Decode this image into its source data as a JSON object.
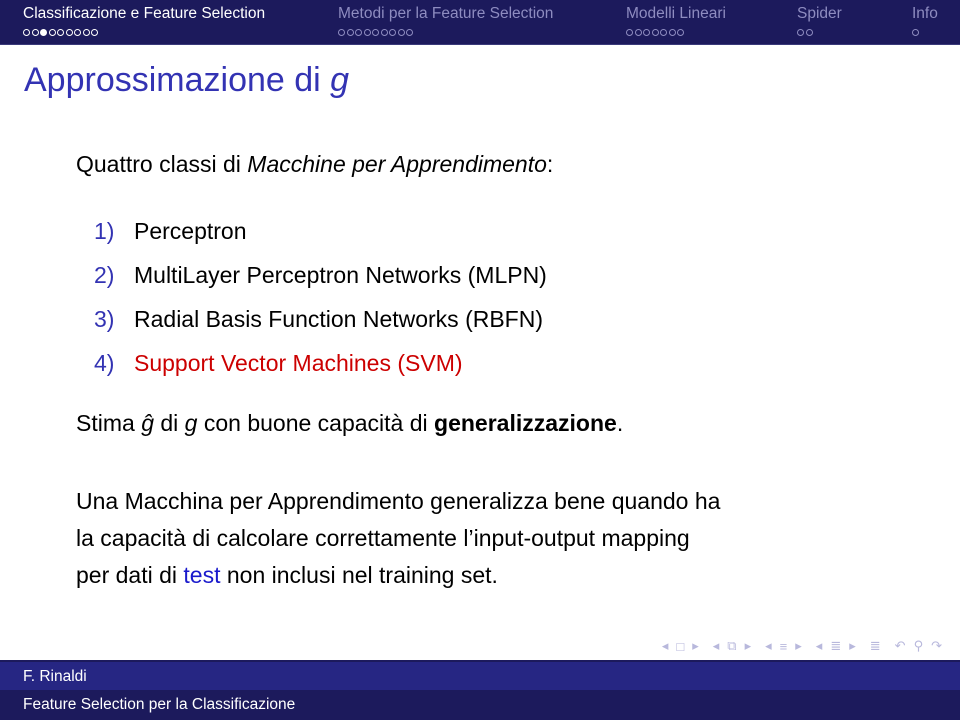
{
  "headline": {
    "sections": [
      {
        "title": "Classificazione e Feature Selection",
        "active": true,
        "dots": 9,
        "current_dot": 3
      },
      {
        "title": "Metodi per la Feature Selection",
        "active": false,
        "dots": 9,
        "current_dot": 0
      },
      {
        "title": "Modelli Lineari",
        "active": false,
        "dots": 7,
        "current_dot": 0
      },
      {
        "title": "Spider",
        "active": false,
        "dots": 2,
        "current_dot": 0
      },
      {
        "title": "Info",
        "active": false,
        "dots": 1,
        "current_dot": 0
      }
    ]
  },
  "frame": {
    "title_prefix": "Approssimazione di ",
    "title_var": "g"
  },
  "content": {
    "intro_prefix": "Quattro classi di ",
    "intro_italic": "Macchine per Apprendimento",
    "intro_suffix": ":",
    "items": [
      {
        "num": "1)",
        "text": "Perceptron",
        "alert": false
      },
      {
        "num": "2)",
        "text": "MultiLayer Perceptron Networks (MLPN)",
        "alert": false
      },
      {
        "num": "3)",
        "text": "Radial Basis Function Networks (RBFN)",
        "alert": false
      },
      {
        "num": "4)",
        "text": "Support Vector Machines (SVM)",
        "alert": true
      }
    ],
    "stima": {
      "w1": "Stima ",
      "ghat": "ĝ",
      "w2": " di ",
      "g": "g",
      "w3": " con buone capacità di ",
      "bold": "generalizzazione",
      "end": "."
    },
    "para": {
      "line1": "Una Macchina per Apprendimento generalizza bene quando ha",
      "line2": "la capacità di calcolare correttamente l’input-output mapping",
      "line3_pre": "per dati di ",
      "line3_link": "test",
      "line3_post": " non inclusi nel training set."
    }
  },
  "navsymbols": {
    "frame_prev": "◂",
    "frame_icon": "□",
    "frame_next": "▸",
    "sub_prev": "◂",
    "sub_icon": "⧉",
    "sub_next": "▸",
    "sec_prev": "◂",
    "sec_icon": "≡",
    "sec_next": "▸",
    "subsec_prev": "◂",
    "subsec_icon": "≣",
    "subsec_next": "▸",
    "doc_icon": "≣",
    "back": "↶",
    "search": "⚲",
    "forward": "↷"
  },
  "footer": {
    "author": "F. Rinaldi",
    "title": "Feature Selection per la Classificazione"
  },
  "colors": {
    "headline_bg": "#1c1a5c",
    "title": "#3333b3",
    "alert": "#cc0000",
    "link": "#1a1acc"
  }
}
